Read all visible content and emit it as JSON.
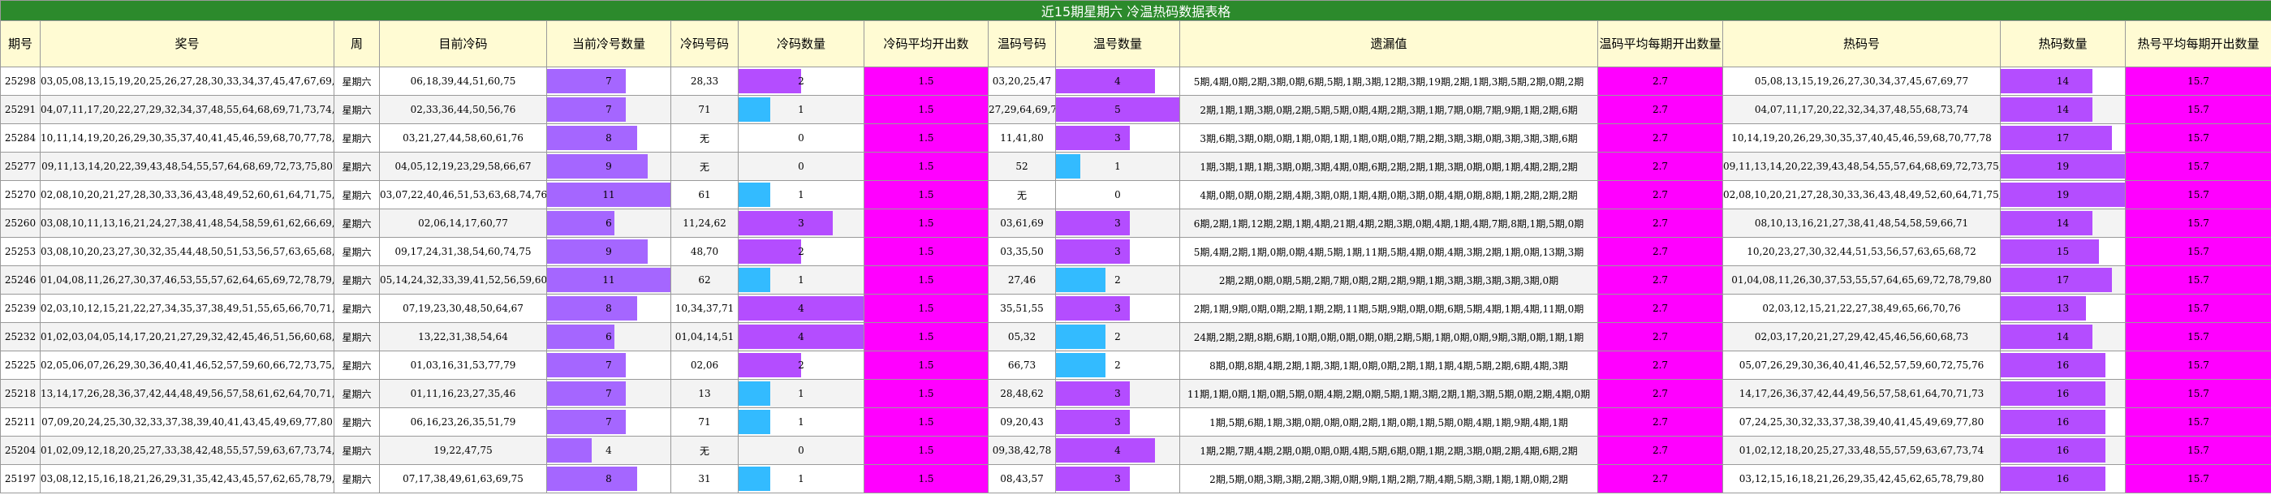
{
  "title": "近15期星期六 冷温热码数据表格",
  "headers": [
    "期号",
    "奖号",
    "周",
    "目前冷码",
    "当前冷号数量",
    "冷码号码",
    "冷码数量",
    "冷码平均开出数",
    "温码号码",
    "温号数量",
    "遗漏值",
    "温码平均每期开出数量",
    "热码号",
    "热码数量",
    "热号平均每期开出数量"
  ],
  "colors": {
    "title_bg": "#2c8a2c",
    "header_bg": "#fffbd3",
    "current_cold_bar": "#a566ff",
    "cold_bar_blue": "#33bbff",
    "cold_bar_purple": "#b44dff",
    "warm_bar_blue": "#33bbff",
    "warm_bar_purple": "#b44dff",
    "hot_bar": "#b44dff",
    "magenta": "#ff00ff"
  },
  "bar_max": {
    "current_cold": 11,
    "cold": 4,
    "warm": 5,
    "hot": 19
  },
  "rows": [
    {
      "qh": "25298",
      "jh": "03,05,08,13,15,19,20,25,26,27,28,30,33,34,37,45,47,67,69,77",
      "zhou": "星期六",
      "mqlm": "06,18,39,44,51,60,75",
      "dqlhsl": 7,
      "lmhm": "28,33",
      "lmsl": 2,
      "lmpj": "1.5",
      "wmhm": "03,20,25,47",
      "whsl": 4,
      "ylz": "5期,4期,0期,2期,3期,0期,6期,5期,1期,3期,12期,3期,19期,2期,1期,3期,5期,2期,0期,2期",
      "wmpj": "2.7",
      "rmh": "05,08,13,15,19,26,27,30,34,37,45,67,69,77",
      "rmsl": 14,
      "rhpj": "15.7"
    },
    {
      "qh": "25291",
      "jh": "04,07,11,17,20,22,27,29,32,34,37,48,55,64,68,69,71,73,74,78",
      "zhou": "星期六",
      "mqlm": "02,33,36,44,50,56,76",
      "dqlhsl": 7,
      "lmhm": "71",
      "lmsl": 1,
      "lmpj": "1.5",
      "wmhm": "27,29,64,69,78",
      "whsl": 5,
      "ylz": "2期,1期,1期,3期,0期,2期,5期,5期,0期,4期,2期,3期,1期,7期,0期,7期,9期,1期,2期,6期",
      "wmpj": "2.7",
      "rmh": "04,07,11,17,20,22,32,34,37,48,55,68,73,74",
      "rmsl": 14,
      "rhpj": "15.7"
    },
    {
      "qh": "25284",
      "jh": "10,11,14,19,20,26,29,30,35,37,40,41,45,46,59,68,70,77,78,80",
      "zhou": "星期六",
      "mqlm": "03,21,27,44,58,60,61,76",
      "dqlhsl": 8,
      "lmhm": "无",
      "lmsl": 0,
      "lmpj": "1.5",
      "wmhm": "11,41,80",
      "whsl": 3,
      "ylz": "3期,6期,3期,0期,0期,1期,0期,1期,1期,0期,0期,7期,2期,3期,3期,0期,3期,3期,3期,6期",
      "wmpj": "2.7",
      "rmh": "10,14,19,20,26,29,30,35,37,40,45,46,59,68,70,77,78",
      "rmsl": 17,
      "rhpj": "15.7"
    },
    {
      "qh": "25277",
      "jh": "09,11,13,14,20,22,39,43,48,54,55,57,64,68,69,72,73,75,80",
      "zhou": "星期六",
      "mqlm": "04,05,12,19,23,29,58,66,67",
      "dqlhsl": 9,
      "lmhm": "无",
      "lmsl": 0,
      "lmpj": "1.5",
      "wmhm": "52",
      "whsl": 1,
      "ylz": "1期,3期,1期,1期,3期,0期,3期,4期,0期,6期,2期,2期,1期,3期,0期,0期,1期,4期,2期,2期",
      "wmpj": "2.7",
      "rmh": "09,11,13,14,20,22,39,43,48,54,55,57,64,68,69,72,73,75,80",
      "rmsl": 19,
      "rhpj": "15.7"
    },
    {
      "qh": "25270",
      "jh": "02,08,10,20,21,27,28,30,33,36,43,48,49,52,60,61,64,71,75,79",
      "zhou": "星期六",
      "mqlm": "03,07,22,40,46,51,53,63,68,74,76",
      "dqlhsl": 11,
      "lmhm": "61",
      "lmsl": 1,
      "lmpj": "1.5",
      "wmhm": "无",
      "whsl": 0,
      "ylz": "4期,0期,0期,0期,2期,4期,3期,0期,1期,4期,0期,3期,0期,4期,0期,8期,1期,2期,2期,2期",
      "wmpj": "2.7",
      "rmh": "02,08,10,20,21,27,28,30,33,36,43,48,49,52,60,64,71,75,79",
      "rmsl": 19,
      "rhpj": "15.7"
    },
    {
      "qh": "25260",
      "jh": "03,08,10,11,13,16,21,24,27,38,41,48,54,58,59,61,62,66,69,71",
      "zhou": "星期六",
      "mqlm": "02,06,14,17,60,77",
      "dqlhsl": 6,
      "lmhm": "11,24,62",
      "lmsl": 3,
      "lmpj": "1.5",
      "wmhm": "03,61,69",
      "whsl": 3,
      "ylz": "6期,2期,1期,12期,2期,1期,4期,21期,4期,2期,3期,0期,4期,1期,4期,7期,8期,1期,5期,0期",
      "wmpj": "2.7",
      "rmh": "08,10,13,16,21,27,38,41,48,54,58,59,66,71",
      "rmsl": 14,
      "rhpj": "15.7"
    },
    {
      "qh": "25253",
      "jh": "03,08,10,20,23,27,30,32,35,44,48,50,51,53,56,57,63,65,68,70,72",
      "zhou": "星期六",
      "mqlm": "09,17,24,31,38,54,60,74,75",
      "dqlhsl": 9,
      "lmhm": "48,70",
      "lmsl": 2,
      "lmpj": "1.5",
      "wmhm": "03,35,50",
      "whsl": 3,
      "ylz": "5期,4期,2期,1期,0期,0期,4期,5期,1期,11期,5期,4期,0期,4期,3期,2期,1期,0期,13期,3期",
      "wmpj": "2.7",
      "rmh": "10,20,23,27,30,32,44,51,53,56,57,63,65,68,72",
      "rmsl": 15,
      "rhpj": "15.7"
    },
    {
      "qh": "25246",
      "jh": "01,04,08,11,26,27,30,37,46,53,55,57,62,64,65,69,72,78,79,80",
      "zhou": "星期六",
      "mqlm": "05,14,24,32,33,39,41,52,56,59,60",
      "dqlhsl": 11,
      "lmhm": "62",
      "lmsl": 1,
      "lmpj": "1.5",
      "wmhm": "27,46",
      "whsl": 2,
      "ylz": "2期,2期,0期,0期,5期,2期,7期,0期,2期,2期,9期,1期,3期,3期,3期,3期,3期,0期",
      "wmpj": "2.7",
      "rmh": "01,04,08,11,26,30,37,53,55,57,64,65,69,72,78,79,80",
      "rmsl": 17,
      "rhpj": "15.7"
    },
    {
      "qh": "25239",
      "jh": "02,03,10,12,15,21,22,27,34,35,37,38,49,51,55,65,66,70,71,76",
      "zhou": "星期六",
      "mqlm": "07,19,23,30,48,50,64,67",
      "dqlhsl": 8,
      "lmhm": "10,34,37,71",
      "lmsl": 4,
      "lmpj": "1.5",
      "wmhm": "35,51,55",
      "whsl": 3,
      "ylz": "2期,1期,9期,0期,0期,2期,1期,2期,11期,5期,9期,0期,0期,6期,5期,4期,1期,4期,11期,0期",
      "wmpj": "2.7",
      "rmh": "02,03,12,15,21,22,27,38,49,65,66,70,76",
      "rmsl": 13,
      "rhpj": "15.7"
    },
    {
      "qh": "25232",
      "jh": "01,02,03,04,05,14,17,20,21,27,29,32,42,45,46,51,56,60,68,73",
      "zhou": "星期六",
      "mqlm": "13,22,31,38,54,64",
      "dqlhsl": 6,
      "lmhm": "01,04,14,51",
      "lmsl": 4,
      "lmpj": "1.5",
      "wmhm": "05,32",
      "whsl": 2,
      "ylz": "24期,2期,2期,8期,6期,10期,0期,0期,0期,0期,2期,5期,1期,0期,0期,9期,3期,0期,1期,1期",
      "wmpj": "2.7",
      "rmh": "02,03,17,20,21,27,29,42,45,46,56,60,68,73",
      "rmsl": 14,
      "rhpj": "15.7"
    },
    {
      "qh": "25225",
      "jh": "02,05,06,07,26,29,30,36,40,41,46,52,57,59,60,66,72,73,75,76",
      "zhou": "星期六",
      "mqlm": "01,03,16,31,53,77,79",
      "dqlhsl": 7,
      "lmhm": "02,06",
      "lmsl": 2,
      "lmpj": "1.5",
      "wmhm": "66,73",
      "whsl": 2,
      "ylz": "8期,0期,8期,4期,2期,1期,3期,1期,0期,0期,2期,1期,1期,4期,5期,2期,6期,4期,3期",
      "wmpj": "2.7",
      "rmh": "05,07,26,29,30,36,40,41,46,52,57,59,60,72,75,76",
      "rmsl": 16,
      "rhpj": "15.7"
    },
    {
      "qh": "25218",
      "jh": "13,14,17,26,28,36,37,42,44,48,49,56,57,58,61,62,64,70,71,73",
      "zhou": "星期六",
      "mqlm": "01,11,16,23,27,35,46",
      "dqlhsl": 7,
      "lmhm": "13",
      "lmsl": 1,
      "lmpj": "1.5",
      "wmhm": "28,48,62",
      "whsl": 3,
      "ylz": "11期,1期,0期,1期,0期,5期,0期,4期,2期,0期,5期,1期,3期,2期,1期,3期,5期,0期,2期,4期,0期",
      "wmpj": "2.7",
      "rmh": "14,17,26,36,37,42,44,49,56,57,58,61,64,70,71,73",
      "rmsl": 16,
      "rhpj": "15.7"
    },
    {
      "qh": "25211",
      "jh": "07,09,20,24,25,30,32,33,37,38,39,40,41,43,45,49,69,77,80",
      "zhou": "星期六",
      "mqlm": "06,16,23,26,35,51,79",
      "dqlhsl": 7,
      "lmhm": "71",
      "lmsl": 1,
      "lmpj": "1.5",
      "wmhm": "09,20,43",
      "whsl": 3,
      "ylz": "1期,5期,6期,1期,3期,0期,0期,0期,2期,1期,0期,1期,5期,0期,4期,1期,9期,4期,1期",
      "wmpj": "2.7",
      "rmh": "07,24,25,30,32,33,37,38,39,40,41,45,49,69,77,80",
      "rmsl": 16,
      "rhpj": "15.7"
    },
    {
      "qh": "25204",
      "jh": "01,02,09,12,18,20,25,27,33,38,42,48,55,57,59,63,67,73,74,78",
      "zhou": "星期六",
      "mqlm": "19,22,47,75",
      "dqlhsl": 4,
      "lmhm": "无",
      "lmsl": 0,
      "lmpj": "1.5",
      "wmhm": "09,38,42,78",
      "whsl": 4,
      "ylz": "1期,2期,7期,4期,2期,0期,0期,0期,4期,5期,6期,0期,1期,2期,3期,0期,2期,4期,6期,2期",
      "wmpj": "2.7",
      "rmh": "01,02,12,18,20,25,27,33,48,55,57,59,63,67,73,74",
      "rmsl": 16,
      "rhpj": "15.7"
    },
    {
      "qh": "25197",
      "jh": "03,08,12,15,16,18,21,26,29,31,35,42,43,45,57,62,65,78,79,80",
      "zhou": "星期六",
      "mqlm": "07,17,38,49,61,63,69,75",
      "dqlhsl": 8,
      "lmhm": "31",
      "lmsl": 1,
      "lmpj": "1.5",
      "wmhm": "08,43,57",
      "whsl": 3,
      "ylz": "2期,5期,0期,3期,3期,2期,3期,0期,9期,1期,2期,7期,4期,5期,3期,1期,1期,0期,2期",
      "wmpj": "2.7",
      "rmh": "03,12,15,16,18,21,26,29,35,42,45,62,65,78,79,80",
      "rmsl": 16,
      "rhpj": "15.7"
    }
  ]
}
